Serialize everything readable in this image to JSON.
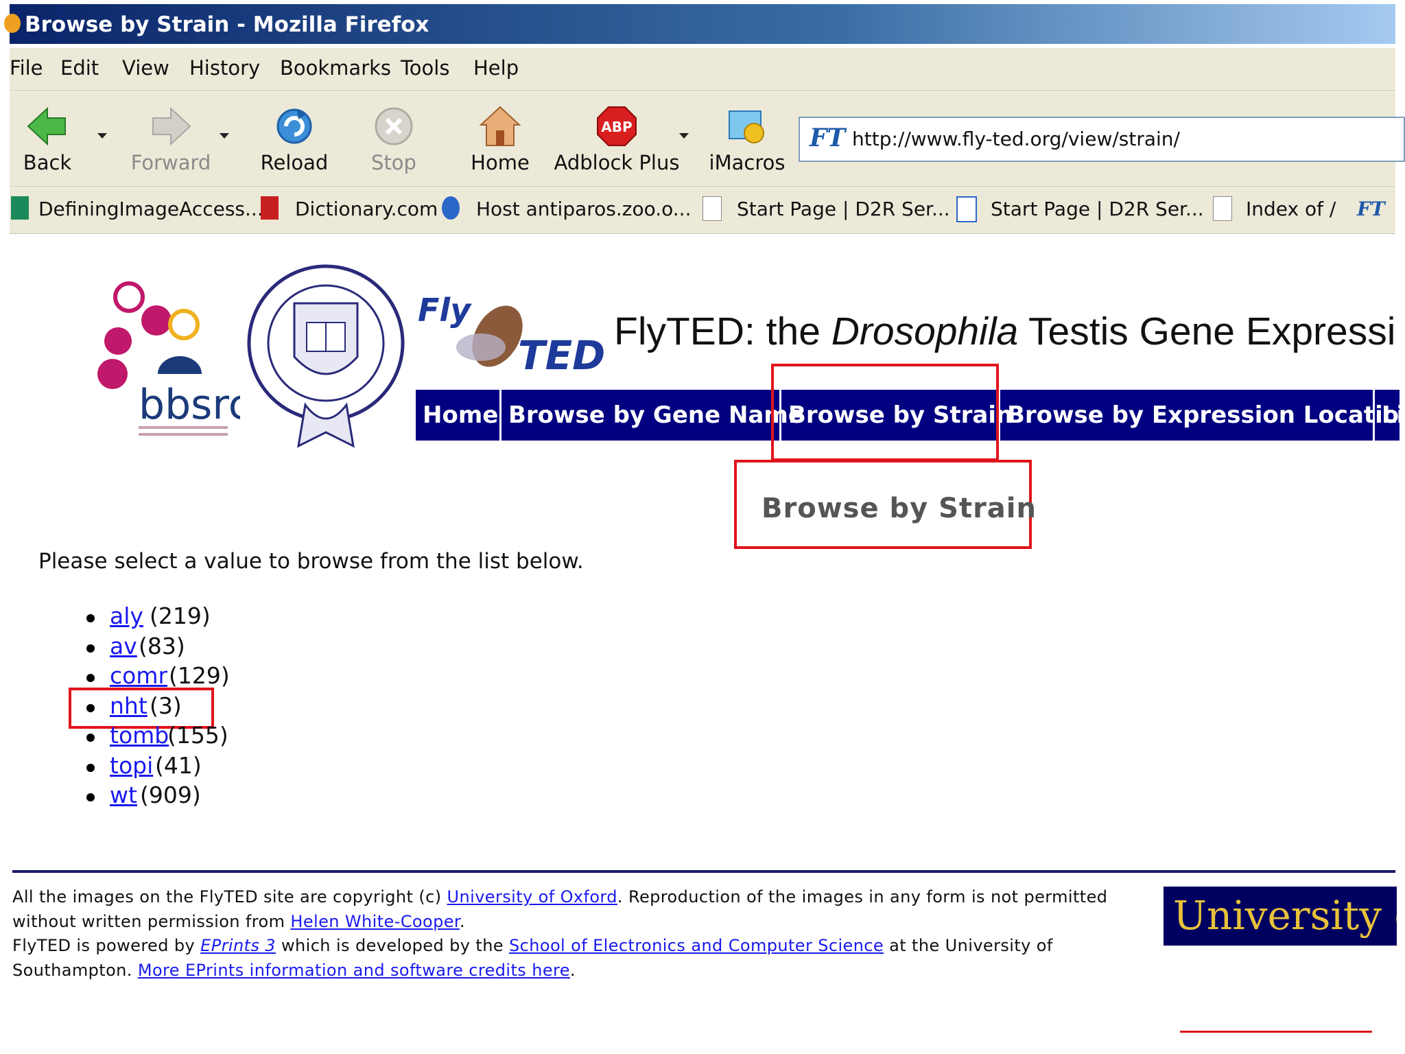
{
  "window": {
    "title": "Browse by Strain - Mozilla Firefox"
  },
  "menu": [
    "File",
    "Edit",
    "View",
    "History",
    "Bookmarks",
    "Tools",
    "Help"
  ],
  "toolbar": {
    "back": "Back",
    "forward": "Forward",
    "reload": "Reload",
    "stop": "Stop",
    "home": "Home",
    "adblock": "Adblock Plus",
    "imacros": "iMacros",
    "adblock_badge": "ABP",
    "url": "http://www.fly-ted.org/view/strain/",
    "url_icon": "FT"
  },
  "bookmarks": [
    "DefiningImageAccess...",
    "Dictionary.com",
    "Host antiparos.zoo.o...",
    "Start Page | D2R Ser...",
    "Start Page | D2R Ser...",
    "Index of /"
  ],
  "site": {
    "logo_bbsrc": "bbsrc",
    "logo_fly": "Fly",
    "logo_ted": "TED",
    "title_pre": "FlyTED: the ",
    "title_em": "Drosophila",
    "title_post": " Testis Gene Expressi",
    "nav": [
      "Home",
      "Browse by Gene Name",
      "Browse by Strain",
      "Browse by Expression Location",
      "Li"
    ]
  },
  "content": {
    "heading": "Browse by Strain",
    "intro": "Please select a value to browse from the list below.",
    "strains": [
      {
        "name": "aly",
        "count": "(219)"
      },
      {
        "name": "av",
        "count": "(83)"
      },
      {
        "name": "comr",
        "count": "(129)"
      },
      {
        "name": "nht",
        "count": "(3)"
      },
      {
        "name": "tomb",
        "count": "(155)"
      },
      {
        "name": "topi",
        "count": "(41)"
      },
      {
        "name": "wt",
        "count": "(909)"
      }
    ]
  },
  "footer": {
    "t1": "All the images on the FlyTED site are copyright (c) ",
    "l1": "University of Oxford",
    "t2": ". Reproduction of the images in any form is not permitted without written permission from ",
    "l2": "Helen White-Cooper",
    "t3": ".",
    "t4": "FlyTED is powered by ",
    "l3": "EPrints 3",
    "t5": " which is developed by the ",
    "l4": "School of Electronics and Computer Science",
    "t6": " at the University of Southampton. ",
    "l5": "More EPrints information and software credits here",
    "t7": ".",
    "badge": "University of"
  },
  "colors": {
    "nav_bg": "#000080",
    "highlight": "#e0141c",
    "link": "#1a1aee",
    "chrome": "#ece9d8"
  }
}
